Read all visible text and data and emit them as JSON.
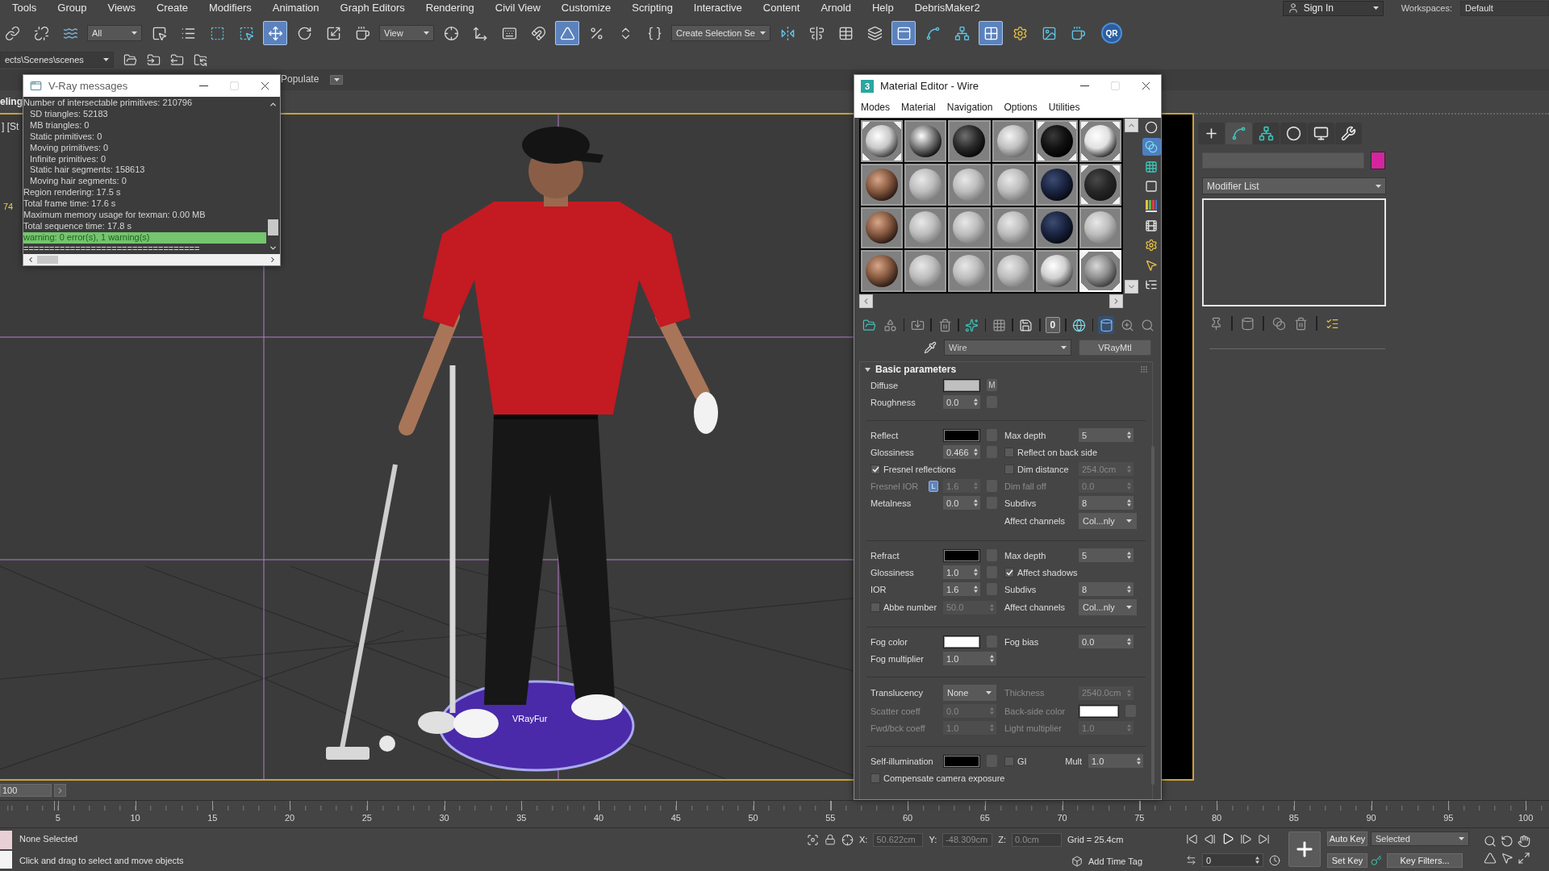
{
  "menu_bar": {
    "items": [
      "Tools",
      "Group",
      "Views",
      "Create",
      "Modifiers",
      "Animation",
      "Graph Editors",
      "Rendering",
      "Civil View",
      "Customize",
      "Scripting",
      "Interactive",
      "Content",
      "Arnold",
      "Help",
      "DebrisMaker2"
    ],
    "sign_in": "Sign In",
    "workspaces_label": "Workspaces:",
    "workspace": "Default"
  },
  "main_toolbar": [
    {
      "kind": "tool",
      "selected": false
    },
    {
      "kind": "tool",
      "selected": false
    },
    {
      "kind": "tool",
      "selected": false
    },
    {
      "kind": "dropdown",
      "value": "All"
    },
    {
      "kind": "tool",
      "selected": false
    },
    {
      "kind": "tool",
      "selected": false
    },
    {
      "kind": "tool",
      "selected": false
    },
    {
      "kind": "tool",
      "selected": false
    },
    {
      "kind": "tool",
      "selected": true
    },
    {
      "kind": "tool",
      "selected": false
    },
    {
      "kind": "tool",
      "selected": false
    },
    {
      "kind": "tool",
      "selected": false
    },
    {
      "kind": "dropdown",
      "value": "View"
    },
    {
      "kind": "tool",
      "selected": false
    },
    {
      "kind": "tool",
      "selected": false
    },
    {
      "kind": "tool",
      "selected": false
    },
    {
      "kind": "tool",
      "selected": false
    },
    {
      "kind": "tool",
      "selected": true
    },
    {
      "kind": "tool",
      "selected": false
    },
    {
      "kind": "tool",
      "selected": false
    },
    {
      "kind": "tool",
      "selected": false
    },
    {
      "kind": "dropdown",
      "value": "Create Selection Se"
    },
    {
      "kind": "tool",
      "selected": false
    },
    {
      "kind": "tool",
      "selected": false
    },
    {
      "kind": "tool",
      "selected": false
    },
    {
      "kind": "tool",
      "selected": false
    },
    {
      "kind": "tool",
      "selected": true
    },
    {
      "kind": "tool",
      "selected": false
    },
    {
      "kind": "tool",
      "selected": false
    },
    {
      "kind": "tool",
      "selected": true
    },
    {
      "kind": "tool",
      "selected": false
    },
    {
      "kind": "tool",
      "selected": false
    },
    {
      "kind": "tool",
      "selected": false
    },
    {
      "kind": "round-button",
      "label": "QR"
    }
  ],
  "project_toolbar": {
    "path": "ects\\Scenes\\scenes"
  },
  "ribbon": {
    "tabs": [
      {
        "label": "Populate",
        "selected": false
      }
    ],
    "panel_label": "eling"
  },
  "viewport": {
    "active": true,
    "label": "] [St",
    "stats_fragment": "74",
    "object_label": "VRayFur"
  },
  "vray_messages": {
    "title": "V-Ray messages",
    "lines": [
      {
        "kind": "info",
        "text": "Number of intersectable primitives: 210796",
        "children": [
          {
            "kind": "info",
            "text": "SD triangles: 52183"
          },
          {
            "kind": "info",
            "text": "MB triangles: 0"
          },
          {
            "kind": "info",
            "text": "Static primitives: 0"
          },
          {
            "kind": "info",
            "text": "Moving primitives: 0"
          },
          {
            "kind": "info",
            "text": "Infinite primitives: 0"
          },
          {
            "kind": "info",
            "text": "Static hair segments: 158613"
          },
          {
            "kind": "info",
            "text": "Moving hair segments: 0"
          }
        ]
      },
      {
        "kind": "info",
        "text": "Region rendering: 17.5 s"
      },
      {
        "kind": "info",
        "text": "Total frame time: 17.6 s"
      },
      {
        "kind": "info",
        "text": "Maximum memory usage for texman: 0.00 MB"
      },
      {
        "kind": "info",
        "text": "Total sequence time: 17.8 s"
      },
      {
        "kind": "warning",
        "text": "warning: 0 error(s), 1 warning(s)"
      },
      {
        "kind": "info",
        "text": "=================================="
      }
    ]
  },
  "material_editor": {
    "logo": "3",
    "title": "Material Editor - Wire",
    "menu": [
      "Modes",
      "Material",
      "Navigation",
      "Options",
      "Utilities"
    ],
    "slots": [
      {
        "kind": "pattern",
        "in_scene": true,
        "selected": false
      },
      {
        "kind": "chrome",
        "in_scene": false,
        "selected": false
      },
      {
        "kind": "dark",
        "in_scene": false,
        "selected": false
      },
      {
        "kind": "dimpled",
        "in_scene": false,
        "selected": false
      },
      {
        "kind": "black",
        "in_scene": true,
        "selected": false
      },
      {
        "kind": "spotted",
        "in_scene": true,
        "selected": false
      },
      {
        "kind": "skin",
        "in_scene": false,
        "selected": false
      },
      {
        "kind": "grey",
        "in_scene": false,
        "selected": false
      },
      {
        "kind": "grey",
        "in_scene": false,
        "selected": false
      },
      {
        "kind": "grey",
        "in_scene": false,
        "selected": false
      },
      {
        "kind": "navy",
        "in_scene": false,
        "selected": false
      },
      {
        "kind": "charcoal",
        "in_scene": true,
        "selected": false
      },
      {
        "kind": "skin",
        "in_scene": false,
        "selected": false
      },
      {
        "kind": "grey",
        "in_scene": false,
        "selected": false
      },
      {
        "kind": "grey",
        "in_scene": false,
        "selected": false
      },
      {
        "kind": "grey",
        "in_scene": false,
        "selected": false
      },
      {
        "kind": "navy",
        "in_scene": false,
        "selected": false
      },
      {
        "kind": "grey",
        "in_scene": false,
        "selected": false
      },
      {
        "kind": "skin",
        "in_scene": false,
        "selected": false
      },
      {
        "kind": "grey",
        "in_scene": false,
        "selected": false
      },
      {
        "kind": "grey",
        "in_scene": false,
        "selected": false
      },
      {
        "kind": "grey",
        "in_scene": false,
        "selected": false
      },
      {
        "kind": "cloth",
        "in_scene": false,
        "selected": false
      },
      {
        "kind": "mesh",
        "in_scene": true,
        "selected": true
      }
    ],
    "side_tools": [
      {
        "selected": false
      },
      {
        "selected": true
      },
      {
        "selected": false
      },
      {
        "selected": false
      },
      {
        "selected": false
      },
      {
        "selected": false
      },
      {
        "selected": false
      },
      {
        "selected": false
      },
      {
        "selected": false
      }
    ],
    "tools": [
      {
        "kind": "icon",
        "selected": false
      },
      {
        "kind": "icon",
        "selected": false
      },
      {
        "kind": "separator"
      },
      {
        "kind": "icon",
        "selected": false
      },
      {
        "kind": "separator"
      },
      {
        "kind": "icon",
        "selected": false
      },
      {
        "kind": "separator"
      },
      {
        "kind": "icon",
        "selected": false
      },
      {
        "kind": "separator"
      },
      {
        "kind": "icon",
        "selected": false
      },
      {
        "kind": "separator"
      },
      {
        "kind": "icon",
        "selected": false
      },
      {
        "kind": "separator"
      },
      {
        "kind": "text",
        "label": "0",
        "selected": false
      },
      {
        "kind": "separator"
      },
      {
        "kind": "icon",
        "selected": false
      },
      {
        "kind": "separator"
      },
      {
        "kind": "icon",
        "selected": true
      },
      {
        "kind": "icon",
        "selected": false
      },
      {
        "kind": "icon",
        "selected": false
      }
    ],
    "material_name": "Wire",
    "material_type": "VRayMtl",
    "rollout": {
      "title": "Basic parameters",
      "expanded": true,
      "groups": [
        [
          {
            "left": [
              {
                "kind": "color",
                "label": "Diffuse",
                "color": "#c0c0c0",
                "map_button": true,
                "map_label": "M"
              }
            ]
          },
          {
            "left": [
              {
                "kind": "spinner",
                "label": "Roughness",
                "value": "0.0",
                "map_button": true
              }
            ]
          }
        ],
        [
          {
            "left": [
              {
                "kind": "color",
                "label": "Reflect",
                "color": "#000000",
                "map_button": true
              }
            ],
            "right": [
              {
                "kind": "spinner",
                "label": "Max depth",
                "value": "5"
              }
            ]
          },
          {
            "left": [
              {
                "kind": "spinner",
                "label": "Glossiness",
                "value": "0.466",
                "map_button": true
              }
            ],
            "right": [
              {
                "kind": "check",
                "label": "Reflect on back side",
                "checked": false
              }
            ]
          },
          {
            "left": [
              {
                "kind": "check",
                "label": "Fresnel reflections",
                "checked": true
              }
            ],
            "right": [
              {
                "kind": "check",
                "label": "Dim distance",
                "checked": false,
                "value": "254.0cm",
                "disabled": true
              }
            ]
          },
          {
            "left": [
              {
                "kind": "spinner",
                "label": "Fresnel IOR",
                "value": "1.6",
                "disabled": true,
                "map_button": true,
                "lock": {
                  "label": "L",
                  "on": true
                }
              }
            ],
            "right": [
              {
                "kind": "spinner",
                "label": "Dim fall off",
                "value": "0.0",
                "disabled": true
              }
            ]
          },
          {
            "left": [
              {
                "kind": "spinner",
                "label": "Metalness",
                "value": "0.0",
                "map_button": true
              }
            ],
            "right": [
              {
                "kind": "spinner",
                "label": "Subdivs",
                "value": "8"
              }
            ]
          },
          {
            "right": [
              {
                "kind": "dropdown",
                "label": "Affect channels",
                "value": "Col...nly"
              }
            ]
          }
        ],
        [
          {
            "left": [
              {
                "kind": "color",
                "label": "Refract",
                "color": "#000000",
                "map_button": true
              }
            ],
            "right": [
              {
                "kind": "spinner",
                "label": "Max depth",
                "value": "5"
              }
            ]
          },
          {
            "left": [
              {
                "kind": "spinner",
                "label": "Glossiness",
                "value": "1.0",
                "map_button": true
              }
            ],
            "right": [
              {
                "kind": "check",
                "label": "Affect shadows",
                "checked": true
              }
            ]
          },
          {
            "left": [
              {
                "kind": "spinner",
                "label": "IOR",
                "value": "1.6",
                "map_button": true
              }
            ],
            "right": [
              {
                "kind": "spinner",
                "label": "Subdivs",
                "value": "8"
              }
            ]
          },
          {
            "left": [
              {
                "kind": "check",
                "label": "Abbe number",
                "checked": false,
                "value": "50.0",
                "disabled": true
              }
            ],
            "right": [
              {
                "kind": "dropdown",
                "label": "Affect channels",
                "value": "Col...nly"
              }
            ]
          }
        ],
        [
          {
            "left": [
              {
                "kind": "color",
                "label": "Fog color",
                "color": "#ffffff",
                "map_button": true
              }
            ],
            "right": [
              {
                "kind": "spinner",
                "label": "Fog bias",
                "value": "0.0"
              }
            ]
          },
          {
            "left": [
              {
                "kind": "spinner",
                "label": "Fog multiplier",
                "value": "1.0"
              }
            ]
          }
        ],
        [
          {
            "left": [
              {
                "kind": "dropdown",
                "label": "Translucency",
                "value": "None"
              }
            ],
            "right": [
              {
                "kind": "spinner",
                "label": "Thickness",
                "value": "2540.0cm",
                "disabled": true
              }
            ]
          },
          {
            "left": [
              {
                "kind": "spinner",
                "label": "Scatter coeff",
                "value": "0.0",
                "disabled": true
              }
            ],
            "right": [
              {
                "kind": "color",
                "label": "Back-side color",
                "color": "#ffffff",
                "disabled": true,
                "map_button": true
              }
            ]
          },
          {
            "left": [
              {
                "kind": "spinner",
                "label": "Fwd/bck coeff",
                "value": "1.0",
                "disabled": true
              }
            ],
            "right": [
              {
                "kind": "spinner",
                "label": "Light multiplier",
                "value": "1.0",
                "disabled": true
              }
            ]
          }
        ],
        [
          {
            "left": [
              {
                "kind": "color",
                "label": "Self-illumination",
                "color": "#000000",
                "map_button": true
              }
            ],
            "right": [
              {
                "kind": "check",
                "label": "GI",
                "checked": false
              },
              {
                "kind": "spinner",
                "label": "Mult",
                "value": "1.0"
              }
            ]
          },
          {
            "left": [
              {
                "kind": "check",
                "label": "Compensate camera exposure",
                "checked": false
              }
            ]
          }
        ]
      ]
    }
  },
  "command_panel": {
    "tabs": [
      {
        "selected": false
      },
      {
        "selected": true
      },
      {
        "selected": false
      },
      {
        "selected": false
      },
      {
        "selected": false
      },
      {
        "selected": false
      }
    ],
    "object_swatch": {
      "color": "#d4259e"
    },
    "modifier_list": "Modifier List"
  },
  "time_slider": {
    "value": "100"
  },
  "track_bar": {
    "labels": [
      "5",
      "10",
      "15",
      "20",
      "25",
      "30",
      "35",
      "40",
      "45",
      "50",
      "55",
      "60",
      "65",
      "70",
      "75",
      "80",
      "85",
      "90",
      "95",
      "100"
    ]
  },
  "status_bar": {
    "selection": "None Selected",
    "prompt": "Click and drag to select and move objects",
    "x_label": "X:",
    "x": "50.622cm",
    "y_label": "Y:",
    "y": "-48.309cm",
    "z_label": "Z:",
    "z": "0.0cm",
    "grid": "Grid = 25.4cm",
    "time_tag": "Add Time Tag",
    "frame": "0",
    "auto_key": {
      "label": "Auto Key",
      "on": false
    },
    "key_mode": "Selected",
    "set_key": "Set Key",
    "key_filters": "Key Filters..."
  }
}
